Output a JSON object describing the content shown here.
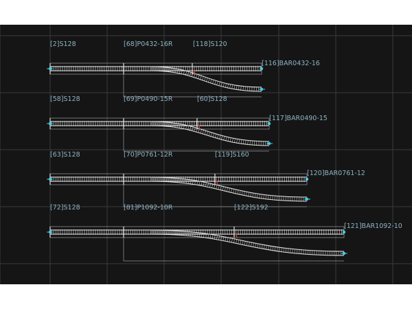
{
  "colors": {
    "background": "#151515",
    "grid": "#3a3a3a",
    "track": "#e6e6e6",
    "label": "#8fb4c4",
    "endpoint": "#3fd0e8",
    "frog": "#d23a3a"
  },
  "rows": [
    {
      "labels": {
        "left": "[2]S128",
        "turnout": "[68]P0432-16R",
        "straight": "[118]S120",
        "end": "[116]BAR0432-16"
      }
    },
    {
      "labels": {
        "left": "[58]S128",
        "turnout": "[69]P0490-15R",
        "straight": "[60]S128",
        "end": "[117]BAR0490-15"
      }
    },
    {
      "labels": {
        "left": "[63]S128",
        "turnout": "[70]P0761-12R",
        "straight": "[119]S160",
        "end": "[120]BAR0761-12"
      }
    },
    {
      "labels": {
        "left": "[72]S128",
        "turnout": "[81]P1092-10R",
        "straight": "[122]S192",
        "end": "[121]BAR1092-10"
      }
    }
  ]
}
